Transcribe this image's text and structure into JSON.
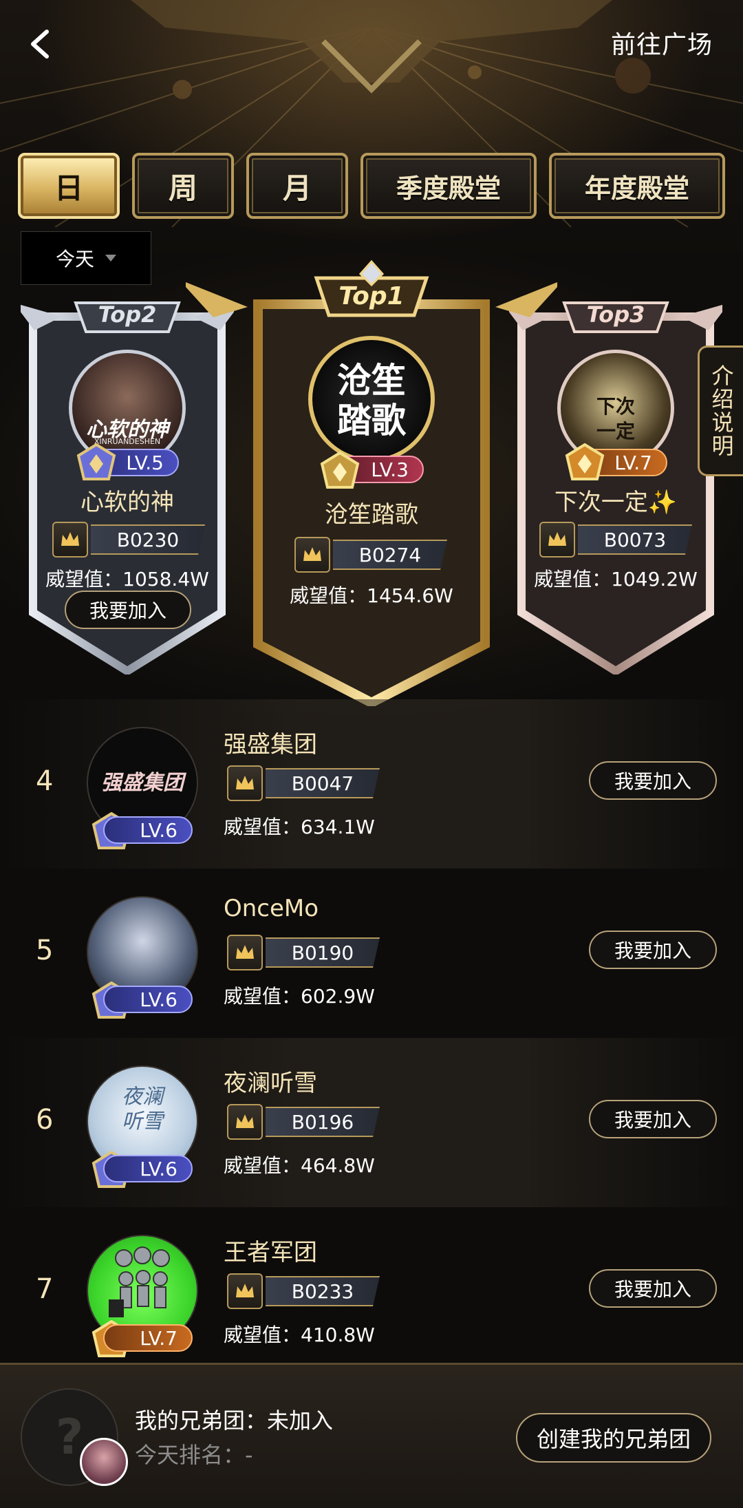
{
  "header": {
    "plaza_link": "前往广场"
  },
  "tabs": [
    {
      "label": "日",
      "active": true
    },
    {
      "label": "周",
      "active": false
    },
    {
      "label": "月",
      "active": false
    },
    {
      "label": "季度殿堂",
      "active": false
    },
    {
      "label": "年度殿堂",
      "active": false
    }
  ],
  "date_filter": {
    "selected": "今天"
  },
  "side_tab": {
    "label": "介绍说明"
  },
  "podium": {
    "top1": {
      "badge": "Top1",
      "avatar_text": "沧笙踏歌",
      "level": "LV.3",
      "name": "沧笙踏歌",
      "code": "B0274",
      "prestige": "威望值：1454.6W"
    },
    "top2": {
      "badge": "Top2",
      "avatar_text": "心软的神",
      "avatar_subtext": "XINRUANDESHEN",
      "level": "LV.5",
      "name": "心软的神",
      "code": "B0230",
      "prestige": "威望值：1058.4W",
      "join": "我要加入"
    },
    "top3": {
      "badge": "Top3",
      "avatar_text": "下次一定",
      "level": "LV.7",
      "name": "下次一定✨",
      "code": "B0073",
      "prestige": "威望值：1049.2W"
    }
  },
  "list": [
    {
      "rank": "4",
      "name": "强盛集团",
      "avatar_text": "强盛集团",
      "level": "LV.6",
      "code": "B0047",
      "prestige": "威望值：634.1W",
      "join": "我要加入"
    },
    {
      "rank": "5",
      "name": "OnceMo",
      "level": "LV.6",
      "code": "B0190",
      "prestige": "威望值：602.9W",
      "join": "我要加入"
    },
    {
      "rank": "6",
      "name": "夜澜听雪",
      "avatar_text": "夜澜听雪",
      "level": "LV.6",
      "code": "B0196",
      "prestige": "威望值：464.8W",
      "join": "我要加入"
    },
    {
      "rank": "7",
      "name": "王者军团",
      "level": "LV.7",
      "code": "B0233",
      "prestige": "威望值：410.8W",
      "join": "我要加入"
    }
  ],
  "footer": {
    "my_group": "我的兄弟团：未加入",
    "today_rank": "今天排名：-",
    "create_button": "创建我的兄弟团",
    "placeholder_glyph": "?"
  },
  "colors": {
    "gold": "#d9b461",
    "lv_blue": "#3a3fa8",
    "lv_red": "#8a2a3f",
    "lv_orange": "#b85a1c"
  }
}
